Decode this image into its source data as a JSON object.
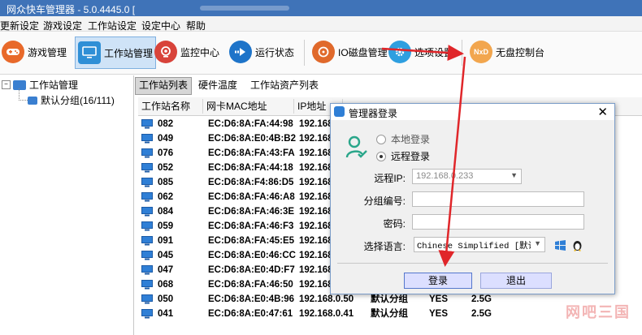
{
  "window": {
    "title": "网众快车管理器 - 5.0.4445.0 ["
  },
  "menu": [
    "更新设定",
    "游戏设定",
    "工作站设定",
    "设定中心",
    "帮助"
  ],
  "toolbar": [
    {
      "label": "游戏管理",
      "icon": "gamepad-icon",
      "color": "#e8692a"
    },
    {
      "label": "工作站管理",
      "icon": "monitor-icon",
      "color": "#2f8fd6",
      "active": true
    },
    {
      "label": "监控中心",
      "icon": "webcam-icon",
      "color": "#d8433a"
    },
    {
      "label": "运行状态",
      "icon": "arrow-right-icon",
      "color": "#1e74c9"
    },
    {
      "label": "IO磁盘管理",
      "icon": "disk-icon",
      "color": "#e0692b"
    },
    {
      "label": "选项设置",
      "icon": "gear-icon",
      "color": "#2e9fe0"
    },
    {
      "label": "无盘控制台",
      "icon": "nxd-icon",
      "color": "#f2a64e",
      "icon_text": "NxD"
    }
  ],
  "tree": {
    "root": "工作站管理",
    "child": "默认分组(16/111)"
  },
  "tabs": [
    "工作站列表",
    "硬件温度",
    "工作站资产列表"
  ],
  "table": {
    "headers": [
      "工作站名称",
      "网卡MAC地址",
      "IP地址"
    ],
    "rows": [
      {
        "name": "082",
        "mac": "EC:D6:8A:FA:44:98",
        "ip": "192.168"
      },
      {
        "name": "049",
        "mac": "EC:D6:8A:E0:4B:B2",
        "ip": "192.168"
      },
      {
        "name": "076",
        "mac": "EC:D6:8A:FA:43:FA",
        "ip": "192.168"
      },
      {
        "name": "052",
        "mac": "EC:D6:8A:FA:44:18",
        "ip": "192.168"
      },
      {
        "name": "085",
        "mac": "EC:D6:8A:F4:86:D5",
        "ip": "192.168"
      },
      {
        "name": "062",
        "mac": "EC:D6:8A:FA:46:A8",
        "ip": "192.168"
      },
      {
        "name": "084",
        "mac": "EC:D6:8A:FA:46:3E",
        "ip": "192.168"
      },
      {
        "name": "059",
        "mac": "EC:D6:8A:FA:46:F3",
        "ip": "192.168"
      },
      {
        "name": "091",
        "mac": "EC:D6:8A:FA:45:E5",
        "ip": "192.168"
      },
      {
        "name": "045",
        "mac": "EC:D6:8A:E0:46:CC",
        "ip": "192.168"
      },
      {
        "name": "047",
        "mac": "EC:D6:8A:E0:4D:F7",
        "ip": "192.168"
      },
      {
        "name": "068",
        "mac": "EC:D6:8A:FA:46:50",
        "ip": "192.168"
      },
      {
        "name": "050",
        "mac": "EC:D6:8A:E0:4B:96",
        "ip": "192.168.0.50",
        "group": "默认分组",
        "flag": "YES",
        "mem": "2.5G"
      },
      {
        "name": "041",
        "mac": "EC:D6:8A:E0:47:61",
        "ip": "192.168.0.41",
        "group": "默认分组",
        "flag": "YES",
        "mem": "2.5G"
      }
    ]
  },
  "dialog": {
    "title": "管理器登录",
    "radio_local": "本地登录",
    "radio_remote": "远程登录",
    "remote_ip_label": "远程IP:",
    "remote_ip_value": "192.168.0.233",
    "group_label": "分组编号:",
    "password_label": "密码:",
    "language_label": "选择语言:",
    "language_value": "Chinese Simplified [默认设]",
    "login_button": "登录",
    "exit_button": "退出"
  },
  "watermark": "网吧三国",
  "colors": {
    "annotation_arrow": "#e0262a",
    "titlebar": "#3f73b8"
  }
}
